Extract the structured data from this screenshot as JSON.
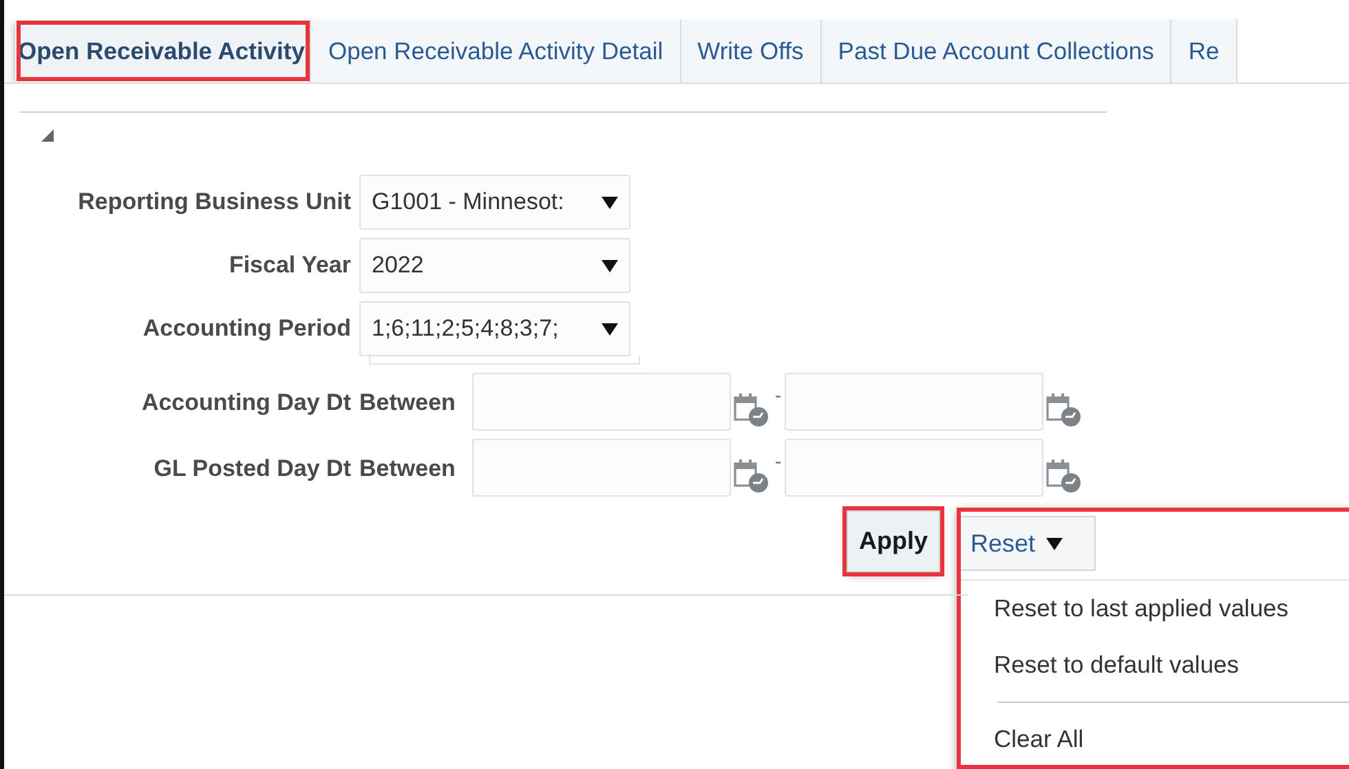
{
  "tabs": [
    {
      "label": "Open Receivable Activity",
      "selected": true,
      "highlighted": true
    },
    {
      "label": "Open Receivable Activity Detail",
      "selected": false,
      "highlighted": false
    },
    {
      "label": "Write Offs",
      "selected": false,
      "highlighted": false
    },
    {
      "label": "Past Due Account Collections",
      "selected": false,
      "highlighted": false
    },
    {
      "label": "Re",
      "selected": false,
      "highlighted": false
    }
  ],
  "prompts": [
    {
      "kind": "select",
      "label": "Reporting Business Unit",
      "value": "G1001 - Minnesot:"
    },
    {
      "kind": "select",
      "label": "Fiscal Year",
      "value": "2022"
    },
    {
      "kind": "select",
      "label": "Accounting Period",
      "value": "1;6;11;2;5;4;8;3;7;"
    },
    {
      "kind": "range",
      "label": "Accounting Day Dt",
      "operator": "Between",
      "separator": "-"
    },
    {
      "kind": "range",
      "label": "GL Posted Day Dt",
      "operator": "Between",
      "separator": "-"
    }
  ],
  "apply_button": {
    "label": "Apply",
    "highlighted": true
  },
  "reset_button": {
    "label": "Reset",
    "expanded": true,
    "highlighted": true
  },
  "reset_menu": [
    {
      "kind": "item",
      "label": "Reset to last applied values"
    },
    {
      "kind": "item",
      "label": "Reset to default values"
    },
    {
      "kind": "separator"
    },
    {
      "kind": "item",
      "label": "Clear All"
    }
  ]
}
